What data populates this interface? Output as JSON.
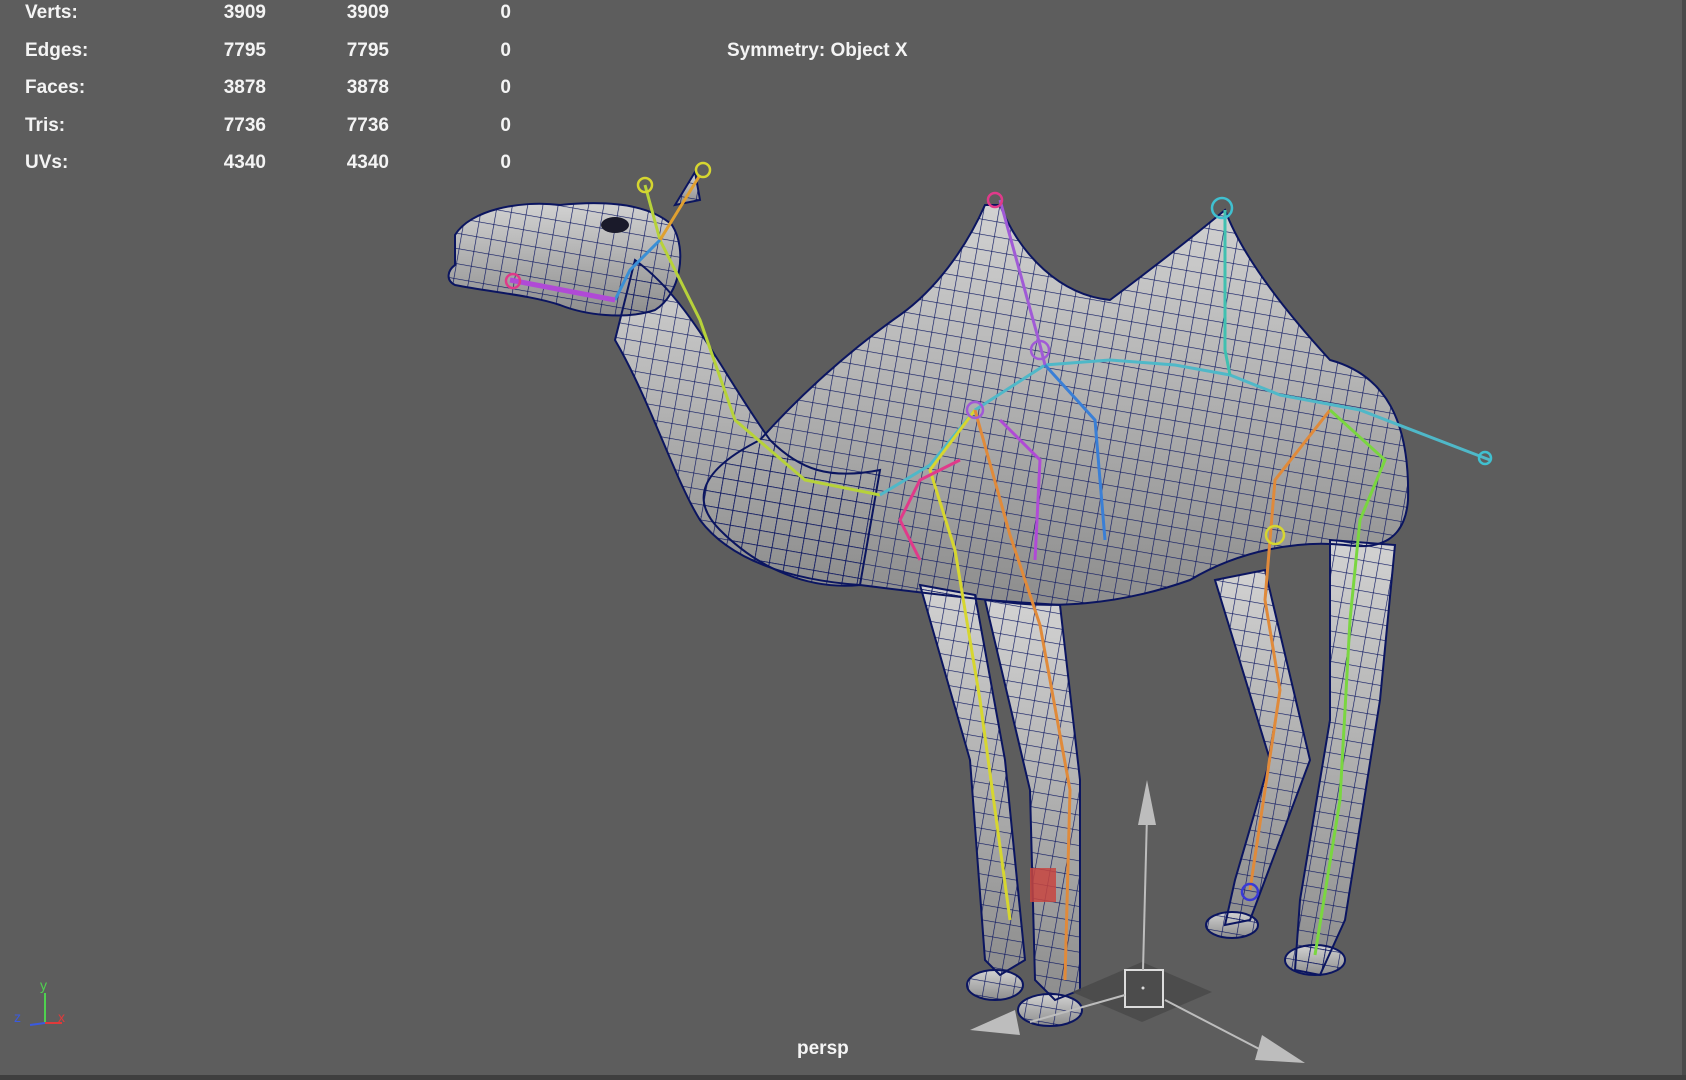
{
  "hud": {
    "rows": [
      {
        "label": "Verts:",
        "v1": "3909",
        "v2": "3909",
        "v3": "0"
      },
      {
        "label": "Edges:",
        "v1": "7795",
        "v2": "7795",
        "v3": "0"
      },
      {
        "label": "Faces:",
        "v1": "3878",
        "v2": "3878",
        "v3": "0"
      },
      {
        "label": "Tris:",
        "v1": "7736",
        "v2": "7736",
        "v3": "0"
      },
      {
        "label": "UVs:",
        "v1": "4340",
        "v2": "4340",
        "v3": "0"
      }
    ],
    "symmetry": "Symmetry: Object X"
  },
  "camera": "persp",
  "axis_indicator": {
    "y": "y",
    "z": "z",
    "x": "x"
  },
  "colors": {
    "background": "#5d5d5d",
    "mesh_fill": "#b9b9b9",
    "wireframe": "#0b1560",
    "hud_text": "#f4f4f4"
  },
  "icons": [
    "move-manipulator-icon",
    "axis-indicator-icon"
  ]
}
